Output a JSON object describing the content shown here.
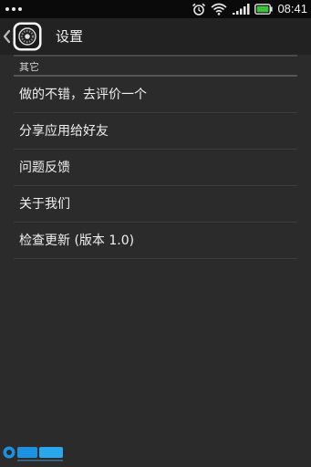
{
  "status_bar": {
    "time": "08:41",
    "icons": [
      "more-dots-icon",
      "alarm-clock-icon",
      "wifi-icon",
      "signal-icon",
      "battery-icon"
    ]
  },
  "action_bar": {
    "title": "设置",
    "back_icon": "chevron-left-icon",
    "app_icon": "app-logo-icon"
  },
  "section": {
    "header": "其它",
    "items": [
      {
        "label": "做的不错，去评价一个"
      },
      {
        "label": "分享应用给好友"
      },
      {
        "label": "问题反馈"
      },
      {
        "label": "关于我们"
      },
      {
        "label": "检查更新 (版本 1.0)"
      }
    ]
  },
  "watermark": {
    "icon": "gogo-logo-icon"
  },
  "colors": {
    "background": "#2b2b2b",
    "status_bar": "#0a0a0a",
    "action_bar": "#222222",
    "text": "#f0f0f0",
    "divider": "#3c3c3c",
    "battery_fill": "#3cc13c"
  }
}
